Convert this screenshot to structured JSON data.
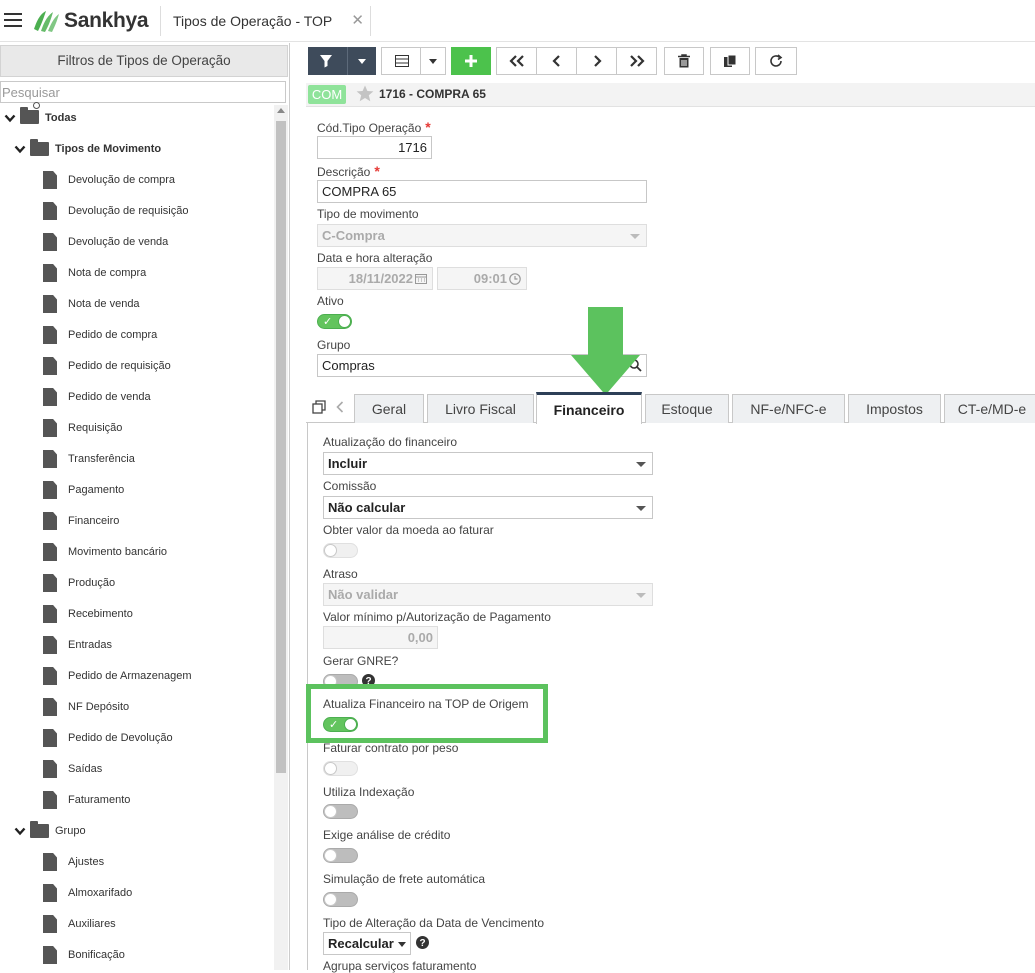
{
  "topbar": {
    "brand": "Sankhya",
    "tab_title": "Tipos de Operação - TOP",
    "close": "✕"
  },
  "left": {
    "header": "Filtros de Tipos de Operação",
    "search_placeholder": "Pesquisar",
    "root": "Todas",
    "group1": "Tipos de Movimento",
    "group1_items": [
      "Devolução de compra",
      "Devolução de requisição",
      "Devolução de venda",
      "Nota de compra",
      "Nota de venda",
      "Pedido de compra",
      "Pedido de requisição",
      "Pedido de venda",
      "Requisição",
      "Transferência",
      "Pagamento",
      "Financeiro",
      "Movimento bancário",
      "Produção",
      "Recebimento",
      "Entradas",
      "Pedido de Armazenagem",
      "NF Depósito",
      "Pedido de Devolução",
      "Saídas",
      "Faturamento"
    ],
    "group2": "Grupo",
    "group2_items": [
      "Ajustes",
      "Almoxarifado",
      "Auxiliares",
      "Bonificação"
    ]
  },
  "record": {
    "badge": "COM",
    "title": "1716 - COMPRA 65"
  },
  "form": {
    "cod_label": "Cód.Tipo Operação",
    "cod_value": "1716",
    "required": "*",
    "desc_label": "Descrição",
    "desc_value": "COMPRA 65",
    "tipo_label": "Tipo de movimento",
    "tipo_value": "C-Compra",
    "data_label": "Data e hora alteração",
    "date_value": "18/11/2022",
    "time_value": "09:01",
    "ativo_label": "Ativo",
    "grupo_label": "Grupo",
    "grupo_value": "Compras"
  },
  "tabs": [
    "Geral",
    "Livro Fiscal",
    "Financeiro",
    "Estoque",
    "NF-e/NFC-e",
    "Impostos",
    "CT-e/MD-e"
  ],
  "active_tab": "Financeiro",
  "fin": {
    "atualizacao_label": "Atualização do financeiro",
    "atualizacao_value": "Incluir",
    "comissao_label": "Comissão",
    "comissao_value": "Não calcular",
    "moeda_label": "Obter valor da moeda ao faturar",
    "atraso_label": "Atraso",
    "atraso_value": "Não validar",
    "valor_min_label": "Valor mínimo p/Autorização de Pagamento",
    "valor_min_value": "0,00",
    "gnre_label": "Gerar GNRE?",
    "atualiza_origem_label": "Atualiza Financeiro na TOP de Origem",
    "faturar_peso_label": "Faturar contrato por peso",
    "indexacao_label": "Utiliza Indexação",
    "credito_label": "Exige análise de crédito",
    "frete_label": "Simulação de frete automática",
    "venc_label": "Tipo de Alteração da Data de Vencimento",
    "venc_value": "Recalcular",
    "agrupa_label": "Agrupa serviços faturamento"
  },
  "colors": {
    "accent_green": "#5cc25e",
    "toggle_on": "#63c45e",
    "badge": "#8fe39a",
    "active_tab_border": "#2d3f57"
  }
}
